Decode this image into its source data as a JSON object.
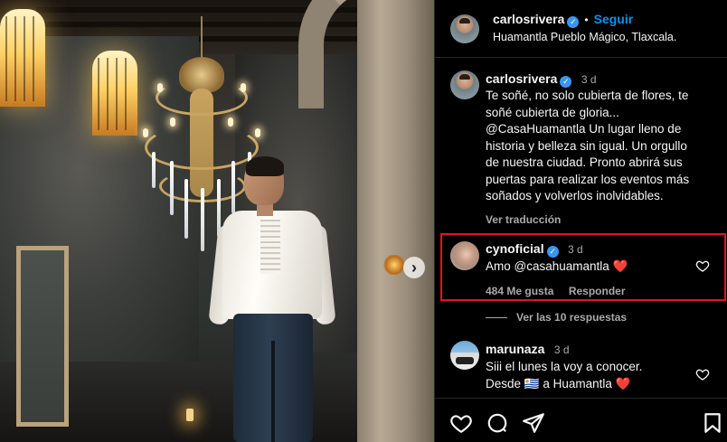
{
  "post": {
    "image_alt": "Hombre con camisa blanca bajo un candelabro en un salón antiguo",
    "next_arrow": "›"
  },
  "header": {
    "username": "carlosrivera",
    "separator": "•",
    "follow_label": "Seguir",
    "location": "Huamantla Pueblo Mágico, Tlaxcala."
  },
  "caption": {
    "username": "carlosrivera",
    "time": "3 d",
    "lines": [
      "Te soñé, no solo cubierta de flores, te",
      "soñé cubierta de gloria...",
      "@CasaHuamantla Un lugar lleno de",
      "historia y belleza sin igual. Un orgullo",
      "de nuestra ciudad. Pronto abrirá sus",
      "puertas para realizar los eventos más",
      "soñados y volverlos inolvidables."
    ],
    "translate_label": "Ver traducción"
  },
  "comments": [
    {
      "username": "cynoficial",
      "time": "3 d",
      "text": "Amo @casahuamantla ❤️",
      "likes": "484 Me gusta",
      "reply_label": "Responder"
    },
    {
      "username": "marunaza",
      "time": "3 d",
      "line1": "Siii el lunes la voy a conocer.",
      "line2": "Desde 🇺🇾 a Huamantla ❤️"
    }
  ],
  "view_replies_label": "Ver las 10 respuestas",
  "colors": {
    "accent": "#0095f6",
    "verified": "#3897f0",
    "highlight": "#e3131b",
    "background": "#000000"
  },
  "icons": {
    "like": "heart-icon",
    "comment": "comment-icon",
    "share": "share-icon",
    "save": "bookmark-icon"
  }
}
